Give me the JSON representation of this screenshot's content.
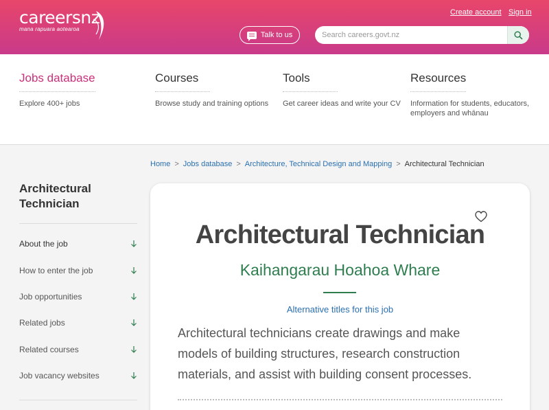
{
  "header": {
    "logo_main": "careers",
    "logo_nz": "nz",
    "logo_sub": "mana rapuara aotearoa",
    "create_account": "Create account",
    "sign_in": "Sign in",
    "talk_label": "Talk to us",
    "search_placeholder": "Search careers.govt.nz"
  },
  "nav": [
    {
      "title": "Jobs database",
      "desc": "Explore 400+ jobs"
    },
    {
      "title": "Courses",
      "desc": "Browse study and training options"
    },
    {
      "title": "Tools",
      "desc": "Get career ideas and write your CV"
    },
    {
      "title": "Resources",
      "desc": "Information for students, educators, employers and whānau"
    }
  ],
  "breadcrumb": {
    "home": "Home",
    "jobs": "Jobs database",
    "category": "Architecture, Technical Design and Mapping",
    "current": "Architectural Technician"
  },
  "sidebar": {
    "title": "Architectural Technician",
    "items": [
      "About the job",
      "How to enter the job",
      "Job opportunities",
      "Related jobs",
      "Related courses",
      "Job vacancy websites"
    ]
  },
  "main": {
    "title": "Architectural Technician",
    "maori_title": "Kaihangarau Hoahoa Whare",
    "alt_titles_link": "Alternative titles for this job",
    "summary": "Architectural technicians create drawings and make models of building structures, research construction materials, and assist with building consent processes."
  },
  "colors": {
    "brand_pink": "#d6407a",
    "accent_green": "#2e7d4f",
    "link_blue": "#2a6fb0"
  }
}
